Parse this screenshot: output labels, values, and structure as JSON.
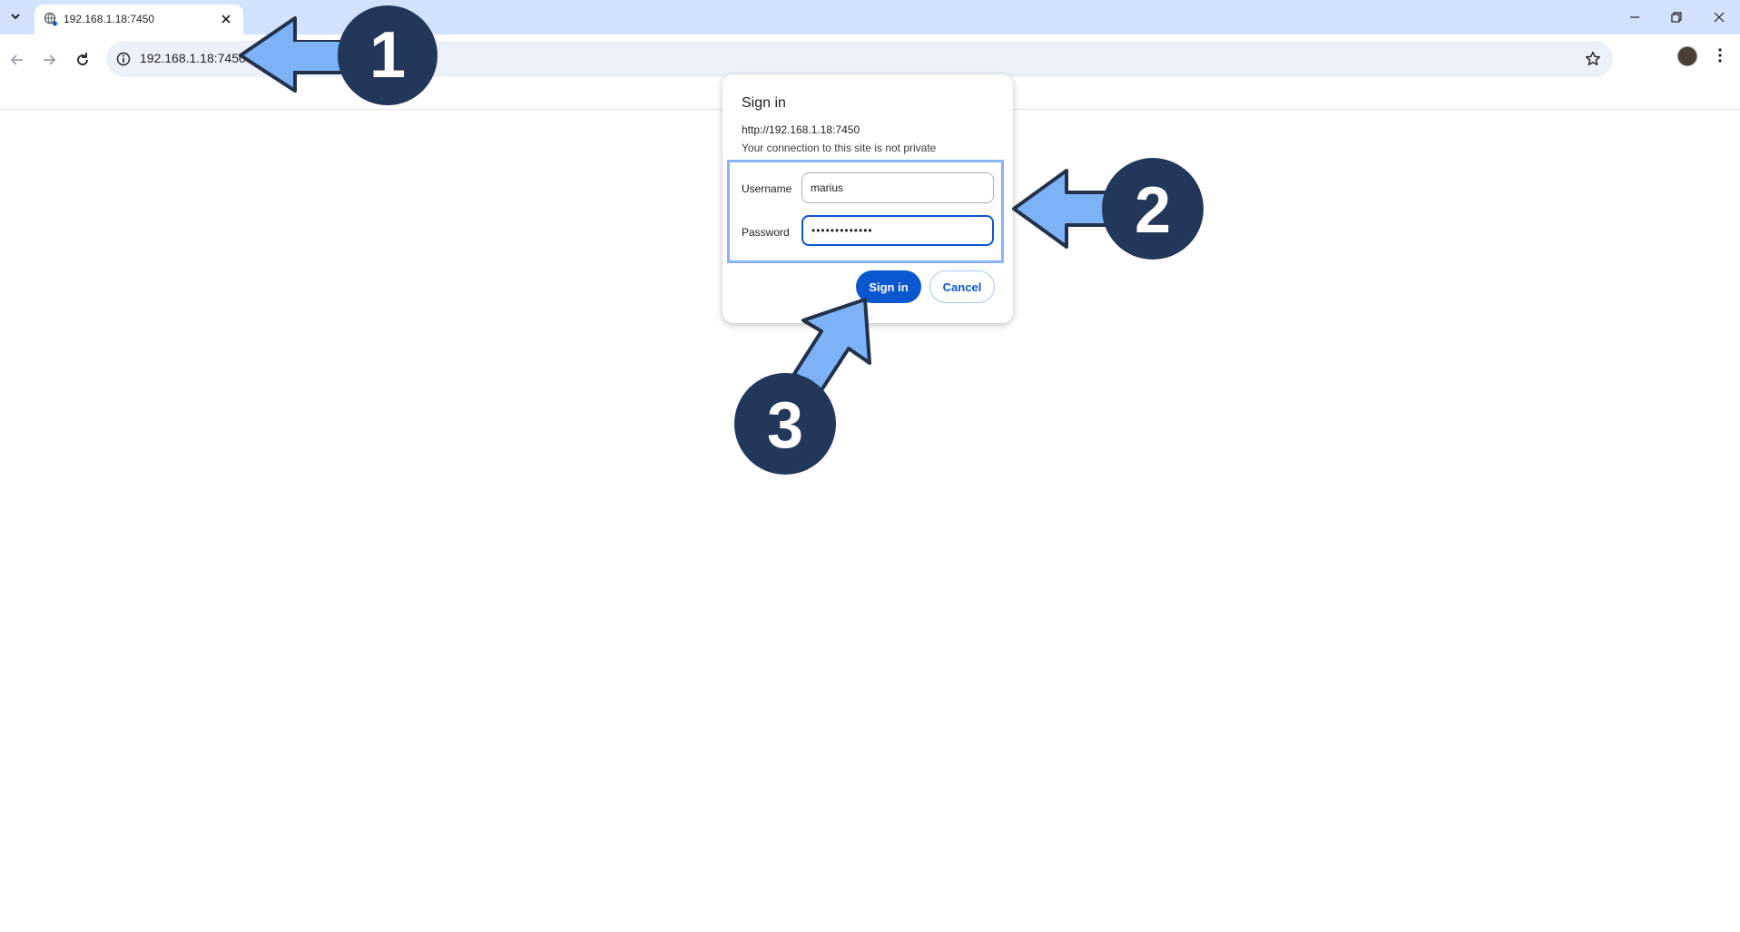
{
  "tab": {
    "title": "192.168.1.18:7450"
  },
  "omnibox": {
    "url": "192.168.1.18:7450"
  },
  "dialog": {
    "title": "Sign in",
    "origin": "http://192.168.1.18:7450",
    "warning": "Your connection to this site is not private",
    "username_label": "Username",
    "username_value": "marius",
    "password_label": "Password",
    "password_value": "•••••••••••••",
    "signin_label": "Sign in",
    "cancel_label": "Cancel"
  },
  "callouts": [
    "1",
    "2",
    "3"
  ],
  "colors": {
    "callout_circle": "#22375a",
    "arrow_fill": "#7eb2f7",
    "primary": "#0b57d0",
    "tabbar": "#d3e3fd"
  },
  "icons": [
    "chevron-down-icon",
    "globe-icon",
    "close-icon",
    "minimize-icon",
    "restore-icon",
    "back-icon",
    "forward-icon",
    "reload-icon",
    "info-icon",
    "star-icon",
    "avatar",
    "kebab-menu-icon"
  ]
}
